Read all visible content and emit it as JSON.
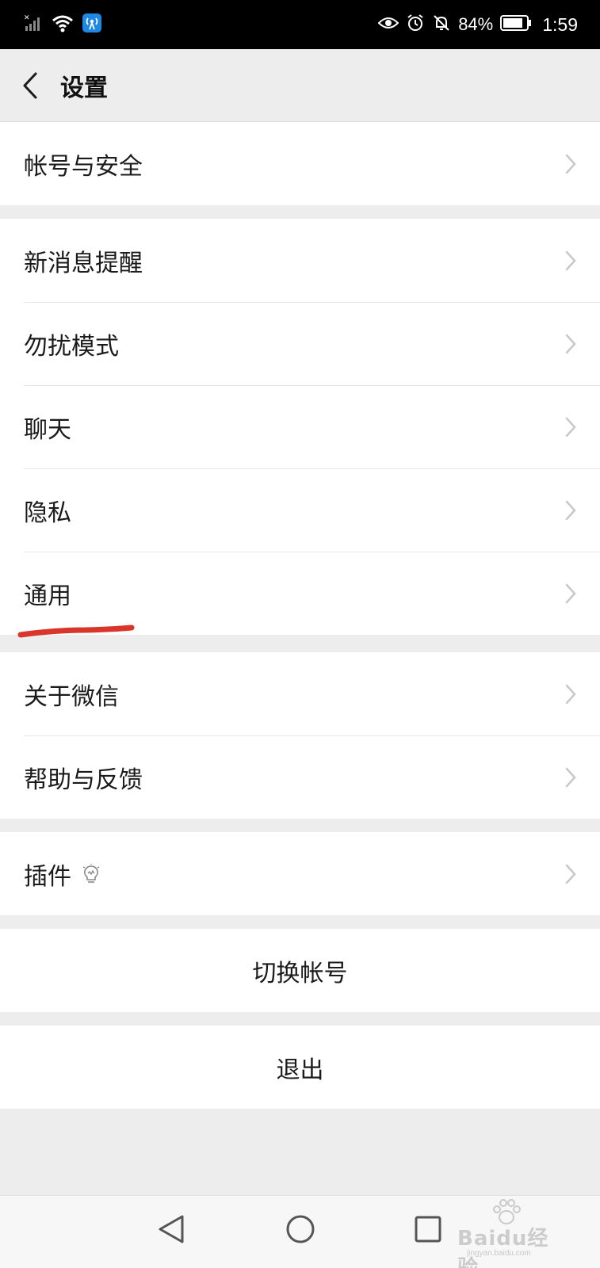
{
  "status_bar": {
    "battery": "84%",
    "time": "1:59"
  },
  "nav": {
    "title": "设置"
  },
  "groups": {
    "account": {
      "items": [
        "帐号与安全"
      ]
    },
    "main": {
      "items": [
        "新消息提醒",
        "勿扰模式",
        "聊天",
        "隐私",
        "通用"
      ]
    },
    "about": {
      "items": [
        "关于微信",
        "帮助与反馈"
      ]
    },
    "plugins": {
      "items": [
        "插件"
      ]
    }
  },
  "actions": {
    "switch_account": "切换帐号",
    "logout": "退出"
  },
  "watermark": {
    "brand": "Baidu经验",
    "url": "jingyan.baidu.com"
  },
  "colors": {
    "underline": "#d9352b",
    "background": "#ededed",
    "status_bar": "#000000"
  },
  "icons": [
    "signal-icon",
    "wifi-icon",
    "hotspot-icon",
    "eye-icon",
    "alarm-icon",
    "bell-off-icon",
    "battery-icon",
    "back-icon",
    "chevron-right-icon",
    "lightbulb-icon",
    "nav-back-icon",
    "nav-home-icon",
    "nav-recents-icon"
  ]
}
